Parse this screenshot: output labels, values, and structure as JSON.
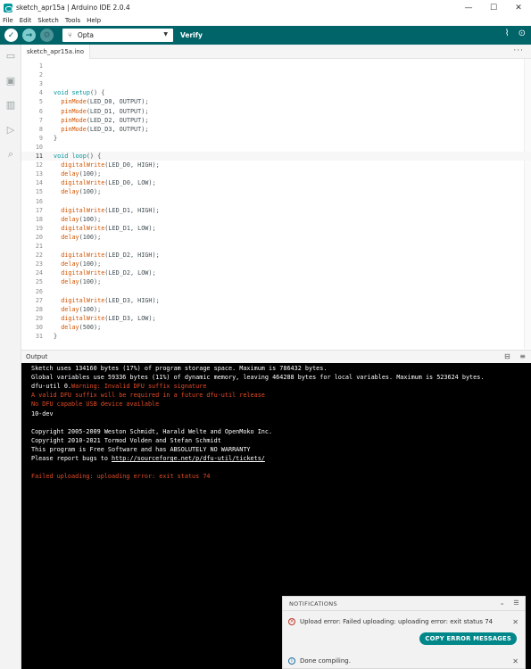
{
  "window": {
    "title": "sketch_apr15a | Arduino IDE 2.0.4",
    "minimize": "—",
    "maximize": "☐",
    "close": "✕"
  },
  "menu": [
    "File",
    "Edit",
    "Sketch",
    "Tools",
    "Help"
  ],
  "toolbar": {
    "board": "Opta",
    "verify_label": "Verify",
    "serial_plotter_icon": "pulse-icon",
    "serial_monitor_icon": "magnifier-dots-icon"
  },
  "tabs": [
    {
      "label": "sketch_apr15a.ino"
    }
  ],
  "editor": {
    "active_line": 11,
    "lines": [
      {
        "n": "1",
        "code": ""
      },
      {
        "n": "2",
        "code": ""
      },
      {
        "n": "3",
        "code": ""
      },
      {
        "n": "4",
        "code": "void setup() {"
      },
      {
        "n": "5",
        "code": "  pinMode(LED_D0, OUTPUT);"
      },
      {
        "n": "6",
        "code": "  pinMode(LED_D1, OUTPUT);"
      },
      {
        "n": "7",
        "code": "  pinMode(LED_D2, OUTPUT);"
      },
      {
        "n": "8",
        "code": "  pinMode(LED_D3, OUTPUT);"
      },
      {
        "n": "9",
        "code": "}"
      },
      {
        "n": "10",
        "code": ""
      },
      {
        "n": "11",
        "code": "void loop() {"
      },
      {
        "n": "12",
        "code": "  digitalWrite(LED_D0, HIGH);"
      },
      {
        "n": "13",
        "code": "  delay(100);"
      },
      {
        "n": "14",
        "code": "  digitalWrite(LED_D0, LOW);"
      },
      {
        "n": "15",
        "code": "  delay(100);"
      },
      {
        "n": "16",
        "code": ""
      },
      {
        "n": "17",
        "code": "  digitalWrite(LED_D1, HIGH);"
      },
      {
        "n": "18",
        "code": "  delay(100);"
      },
      {
        "n": "19",
        "code": "  digitalWrite(LED_D1, LOW);"
      },
      {
        "n": "20",
        "code": "  delay(100);"
      },
      {
        "n": "21",
        "code": ""
      },
      {
        "n": "22",
        "code": "  digitalWrite(LED_D2, HIGH);"
      },
      {
        "n": "23",
        "code": "  delay(100);"
      },
      {
        "n": "24",
        "code": "  digitalWrite(LED_D2, LOW);"
      },
      {
        "n": "25",
        "code": "  delay(100);"
      },
      {
        "n": "26",
        "code": ""
      },
      {
        "n": "27",
        "code": "  digitalWrite(LED_D3, HIGH);"
      },
      {
        "n": "28",
        "code": "  delay(100);"
      },
      {
        "n": "29",
        "code": "  digitalWrite(LED_D3, LOW);"
      },
      {
        "n": "30",
        "code": "  delay(500);"
      },
      {
        "n": "31",
        "code": "}"
      }
    ]
  },
  "output": {
    "label": "Output",
    "lines": [
      {
        "type": "normal",
        "text": "Sketch uses 134160 bytes (17%) of program storage space. Maximum is 786432 bytes."
      },
      {
        "type": "normal",
        "text": "Global variables use 59336 bytes (11%) of dynamic memory, leaving 464288 bytes for local variables. Maximum is 523624 bytes."
      },
      {
        "type": "mixed",
        "text": "dfu-util 0.",
        "warn": "Warning: Invalid DFU suffix signature"
      },
      {
        "type": "error",
        "text": "A valid DFU suffix will be required in a future dfu-util release"
      },
      {
        "type": "error",
        "text": "No DFU capable USB device available"
      },
      {
        "type": "normal",
        "text": "10-dev"
      },
      {
        "type": "blank",
        "text": ""
      },
      {
        "type": "normal",
        "text": "Copyright 2005-2009 Weston Schmidt, Harald Welte and OpenMoko Inc."
      },
      {
        "type": "normal",
        "text": "Copyright 2010-2021 Tormod Volden and Stefan Schmidt"
      },
      {
        "type": "normal",
        "text": "This program is Free Software and has ABSOLUTELY NO WARRANTY"
      },
      {
        "type": "link",
        "text": "Please report bugs to ",
        "link": "http://sourceforge.net/p/dfu-util/tickets/"
      },
      {
        "type": "blank",
        "text": ""
      },
      {
        "type": "error",
        "text": "Failed uploading: uploading error: exit status 74"
      }
    ]
  },
  "notifications": {
    "header": "NOTIFICATIONS",
    "items": [
      {
        "kind": "error",
        "text": "Upload error: Failed uploading: uploading error: exit status 74",
        "action": "COPY ERROR MESSAGES"
      },
      {
        "kind": "info",
        "text": "Done compiling."
      }
    ]
  },
  "colors": {
    "toolbar": "#006468",
    "accent": "#00979c",
    "function": "#d35400",
    "console_bg": "#000000",
    "error_text": "#e34c26"
  }
}
